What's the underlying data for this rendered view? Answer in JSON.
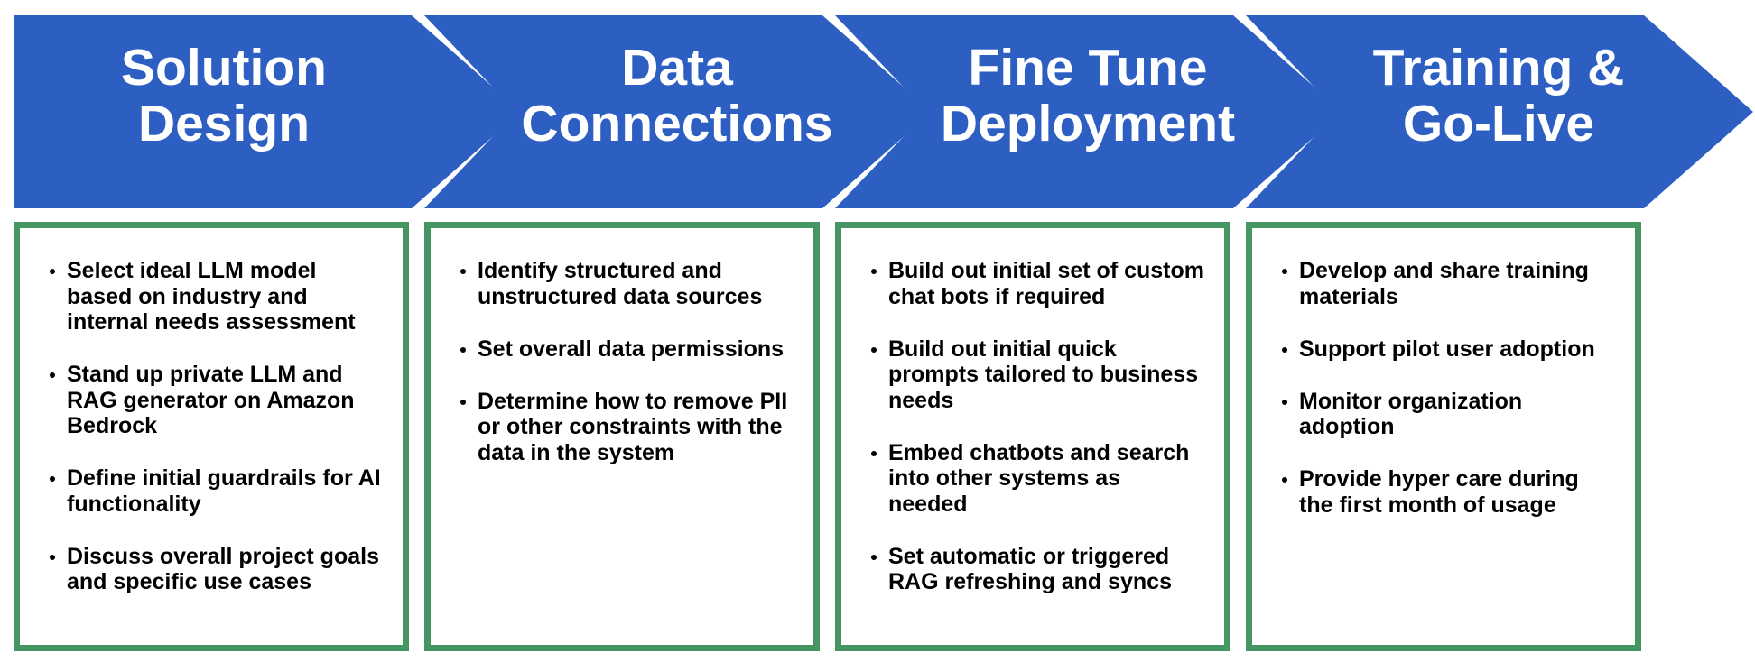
{
  "colors": {
    "chevron": "#2D5FC3",
    "box_border": "#459663",
    "title_text": "#FFFFFF",
    "body_text": "#000000"
  },
  "stages": [
    {
      "title_lines": [
        "Solution",
        "Design"
      ],
      "bullets": [
        "Select ideal LLM model based on industry and internal needs assessment",
        "Stand up private LLM and RAG generator on Amazon Bedrock",
        "Define initial guardrails for AI functionality",
        "Discuss overall project goals and specific use cases"
      ]
    },
    {
      "title_lines": [
        "Data",
        "Connections"
      ],
      "bullets": [
        "Identify structured and unstructured data sources",
        "Set overall data permissions",
        "Determine how to remove PII or other constraints with the data in the system"
      ]
    },
    {
      "title_lines": [
        "Fine Tune",
        "Deployment"
      ],
      "bullets": [
        "Build out initial set of custom chat bots if required",
        "Build out initial quick prompts tailored to business needs",
        "Embed chatbots and search into other systems as needed",
        "Set automatic or triggered RAG refreshing and syncs"
      ]
    },
    {
      "title_lines": [
        "Training &",
        "Go-Live"
      ],
      "bullets": [
        "Develop and share training materials",
        "Support pilot user adoption",
        "Monitor organization adoption",
        "Provide hyper care during the first month of usage"
      ]
    }
  ]
}
